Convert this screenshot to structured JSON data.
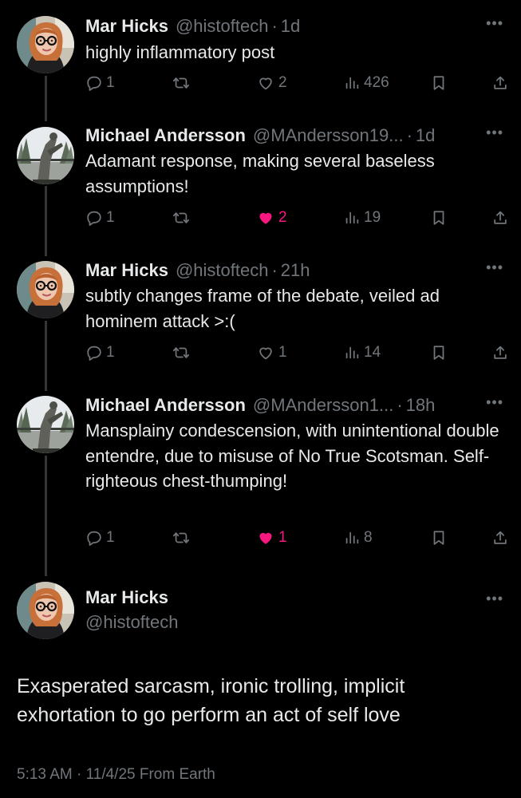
{
  "colors": {
    "background": "#000000",
    "primary_text": "#e7e9ea",
    "secondary_text": "#71767b",
    "like_active": "#f91880",
    "thread_line": "#333639"
  },
  "replies": [
    {
      "name": "Mar Hicks",
      "handle": "@histoftech",
      "separator": "·",
      "time": "1d",
      "text": "highly inflammatory post",
      "reply_count": "1",
      "like_count": "2",
      "liked": false,
      "view_count": "426",
      "avatar": "portrait-red-hair-glasses"
    },
    {
      "name": "Michael Andersson",
      "handle": "@MAndersson19...",
      "separator": "·",
      "time": "1d",
      "text": "Adamant response, making several baseless assumptions!",
      "reply_count": "1",
      "like_count": "2",
      "liked": true,
      "view_count": "19",
      "avatar": "photo-statue-trees"
    },
    {
      "name": "Mar Hicks",
      "handle": "@histoftech",
      "separator": "·",
      "time": "21h",
      "text": "subtly changes frame of the debate, veiled ad hominem attack >:(",
      "reply_count": "1",
      "like_count": "1",
      "liked": false,
      "view_count": "14",
      "avatar": "portrait-red-hair-glasses"
    },
    {
      "name": "Michael Andersson",
      "handle": "@MAndersson1...",
      "separator": "·",
      "time": "18h",
      "text": "Mansplainy condescension, with unintentional double entendre, due to misuse of No True Scotsman. Self-righteous chest-thumping!",
      "reply_count": "1",
      "like_count": "1",
      "liked": true,
      "view_count": "8",
      "avatar": "photo-statue-trees"
    }
  ],
  "main_post": {
    "name": "Mar Hicks",
    "handle": "@histoftech",
    "text": "Exasperated sarcasm, ironic trolling, implicit exhortation to go perform an act of self love",
    "meta": "5:13 AM · 11/4/25 From Earth",
    "avatar": "portrait-red-hair-glasses"
  },
  "icons": {
    "more": "more-dots-icon",
    "reply": "reply-bubble-icon",
    "repost": "repost-arrows-icon",
    "like": "heart-icon",
    "views": "views-bars-icon",
    "bookmark": "bookmark-icon",
    "share": "share-upload-icon"
  },
  "more_glyph": "•••"
}
